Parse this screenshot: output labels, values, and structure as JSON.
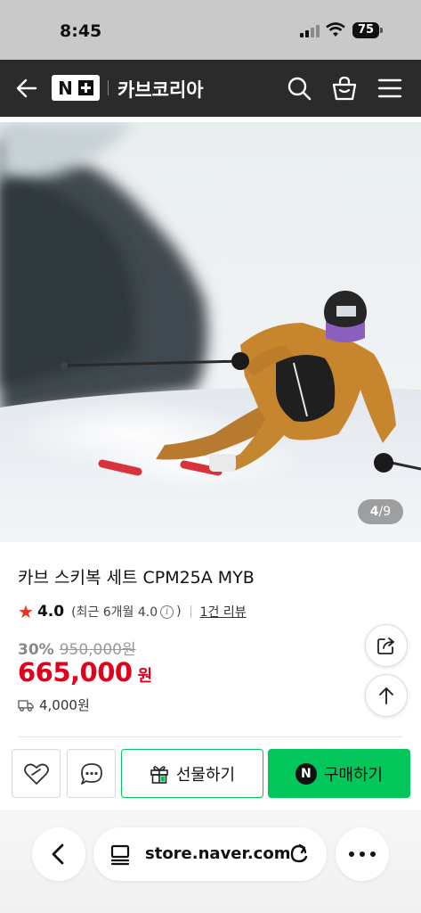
{
  "status_bar": {
    "time": "8:45",
    "battery": "75"
  },
  "header": {
    "logo_n": "N",
    "store_name": "카브코리아"
  },
  "hero": {
    "current": "4",
    "separator": "/",
    "total": "9"
  },
  "product": {
    "title": "카브 스키복 세트 CPM25A MYB",
    "rating": "4.0",
    "recent_rating": "(최근 6개월 4.0",
    "recent_rating_close": ")",
    "review_count": "1건 리뷰",
    "discount_rate": "30%",
    "original_price": "950,000원",
    "price": "665,000",
    "price_unit": "원",
    "shipping_fee": "4,000원"
  },
  "actions": {
    "gift_label": "선물하기",
    "buy_badge": "N",
    "buy_label": "구매하기"
  },
  "browser": {
    "url": "store.naver.com"
  },
  "colors": {
    "price_red": "#e2001a",
    "naver_green": "#03c75a",
    "header_bg": "#2b2b2b",
    "rating_star": "#f0301c"
  },
  "icons": [
    "back-arrow-icon",
    "search-icon",
    "shopping-bag-icon",
    "menu-icon",
    "share-icon",
    "scroll-top-icon",
    "wishlist-heart-icon",
    "talk-icon",
    "gift-icon",
    "truck-icon",
    "browser-back-icon",
    "tabs-icon",
    "reload-icon",
    "more-icon"
  ]
}
